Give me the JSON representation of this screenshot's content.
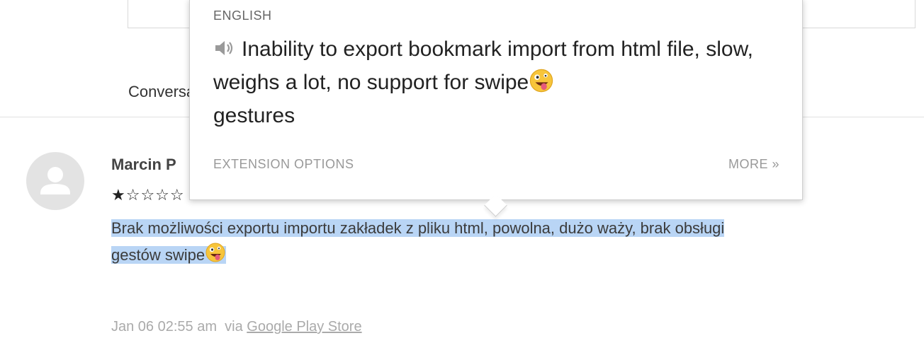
{
  "conversation": {
    "label": "Conversation"
  },
  "review": {
    "author": "Marcin P",
    "stars": "★☆☆☆☆",
    "rating": 1,
    "rating_max": 5,
    "text_line1": "Brak możliwości exportu importu zakładek z pliku html, powolna, dużo waży, brak obsługi",
    "text_line2": "gestów swipe",
    "date": "Jan 06 02:55 am",
    "via_label": "via",
    "source_link": "Google Play Store"
  },
  "popup": {
    "language": "ENGLISH",
    "translation_part1": "Inability to export bookmark import from html file, slow, weighs a lot, no support for swipe",
    "translation_part2": "gestures",
    "options_label": "EXTENSION OPTIONS",
    "more_label": "MORE »"
  },
  "icons": {
    "avatar": "user-silhouette-icon",
    "speaker": "speaker-icon",
    "emoji": "zany-face-emoji"
  },
  "colors": {
    "selection": "#b9d5f5",
    "meta_text": "#aaaaaa",
    "avatar_bg": "#e3e3e3"
  }
}
